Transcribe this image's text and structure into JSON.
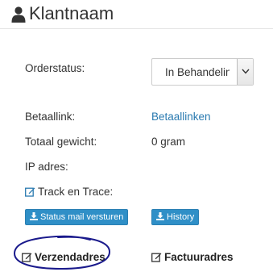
{
  "header": {
    "title": "Klantnaam",
    "icon": "user-icon"
  },
  "orderstatus": {
    "label": "Orderstatus:",
    "selected": "In Behandeling"
  },
  "betaallink": {
    "label": "Betaallink:",
    "value": "Betaallinken"
  },
  "gewicht": {
    "label": "Totaal gewicht:",
    "value": "0 gram"
  },
  "ip": {
    "label": "IP adres:",
    "value": ""
  },
  "track": {
    "label": "Track en Trace:",
    "icon": "edit-icon"
  },
  "buttons": {
    "status_mail": "Status mail versturen",
    "history": "History"
  },
  "sections": {
    "verzendadres": "Verzendadres",
    "factuuradres": "Factuuradres"
  },
  "colors": {
    "link": "#2a7ab0",
    "button": "#2f8fc7",
    "annotation": "#1a1a8c"
  }
}
